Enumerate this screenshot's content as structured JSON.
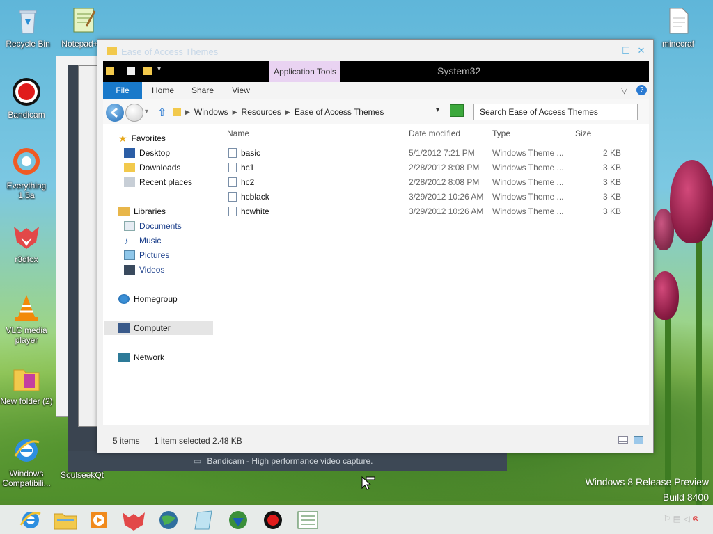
{
  "desktop": {
    "icons": [
      {
        "label": "Recycle Bin"
      },
      {
        "label": "Notepad++"
      },
      {
        "label": "Bandicam"
      },
      {
        "label": "Everything 1.5a"
      },
      {
        "label": "r3dfox"
      },
      {
        "label": "VLC media player"
      },
      {
        "label": "New folder (2)"
      },
      {
        "label": "Windows Compatibili..."
      },
      {
        "label": "SoulseekQt"
      },
      {
        "label": "minecraf"
      }
    ],
    "release_line1": "Windows 8 Release Preview",
    "release_line2": "Build 8400"
  },
  "background_windows": {
    "bandicam_caption": "Bandicam - High performance video capture."
  },
  "explorer": {
    "title": "Ease of Access Themes",
    "app_tools_label": "Application Tools",
    "context_title": "System32",
    "ribbon_tabs": [
      "File",
      "Home",
      "Share",
      "View"
    ],
    "breadcrumb": [
      "Windows",
      "Resources",
      "Ease of Access Themes"
    ],
    "search_placeholder": "Search Ease of Access Themes",
    "nav": {
      "favorites": "Favorites",
      "desktop": "Desktop",
      "downloads": "Downloads",
      "recent": "Recent places",
      "libraries": "Libraries",
      "documents": "Documents",
      "music": "Music",
      "pictures": "Pictures",
      "videos": "Videos",
      "homegroup": "Homegroup",
      "computer": "Computer",
      "network": "Network"
    },
    "columns": [
      "Name",
      "Date modified",
      "Type",
      "Size"
    ],
    "files": [
      {
        "name": "basic",
        "date": "5/1/2012 7:21 PM",
        "type": "Windows Theme ...",
        "size": "2 KB"
      },
      {
        "name": "hc1",
        "date": "2/28/2012 8:08 PM",
        "type": "Windows Theme ...",
        "size": "3 KB"
      },
      {
        "name": "hc2",
        "date": "2/28/2012 8:08 PM",
        "type": "Windows Theme ...",
        "size": "3 KB"
      },
      {
        "name": "hcblack",
        "date": "3/29/2012 10:26 AM",
        "type": "Windows Theme ...",
        "size": "3 KB"
      },
      {
        "name": "hcwhite",
        "date": "3/29/2012 10:26 AM",
        "type": "Windows Theme ...",
        "size": "3 KB"
      }
    ],
    "status": {
      "count": "5 items",
      "selection": "1 item selected  2.48 KB"
    }
  },
  "taskbar": {
    "apps": [
      "internet-explorer-icon",
      "file-explorer-icon",
      "media-player-icon",
      "r3dfox-icon",
      "globe-icon",
      "notepad-icon",
      "download-manager-icon",
      "bandicam-icon",
      "list-app-icon"
    ]
  },
  "colors": {
    "file_tab": "#1979ca",
    "app_tools": "#e9d3f2",
    "link": "#1a3e8a"
  }
}
